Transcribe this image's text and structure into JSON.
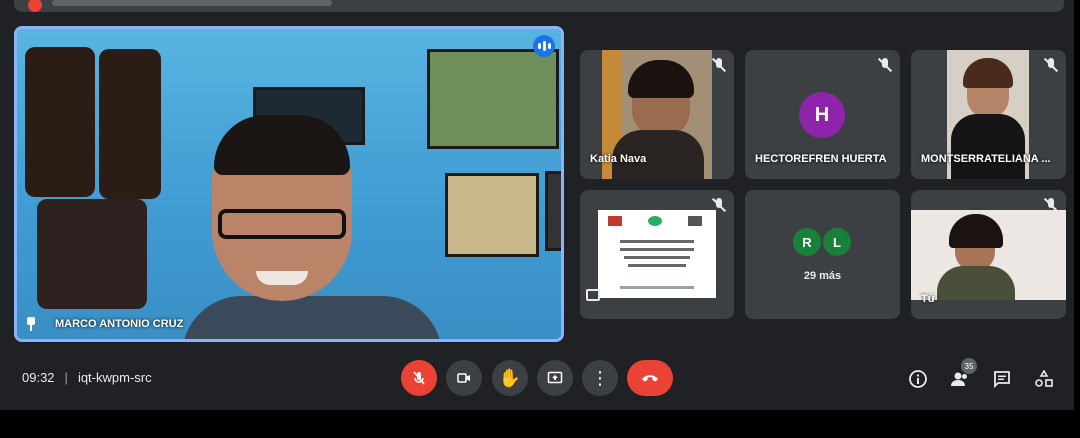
{
  "main_speaker": {
    "name": "MARCO ANTONIO CRUZ"
  },
  "tiles": [
    {
      "name": "Katia Nava"
    },
    {
      "name": "HECTOREFREN HUERTA",
      "initial": "H",
      "avatar_color": "#8e24aa"
    },
    {
      "name": "MONTSERRATELIANA ..."
    },
    {
      "name": ""
    },
    {
      "name": "29 más",
      "initials": [
        "R",
        "L"
      ],
      "avatar_color": "#188038"
    },
    {
      "name": "Tú"
    }
  ],
  "meeting": {
    "time": "09:32",
    "separator": "|",
    "code": "iqt-kwpm-src"
  },
  "people_count": "35",
  "colors": {
    "accent": "#8ab4f8",
    "end_call": "#ea4335",
    "tile_bg": "#3c4043",
    "background": "#202124"
  }
}
